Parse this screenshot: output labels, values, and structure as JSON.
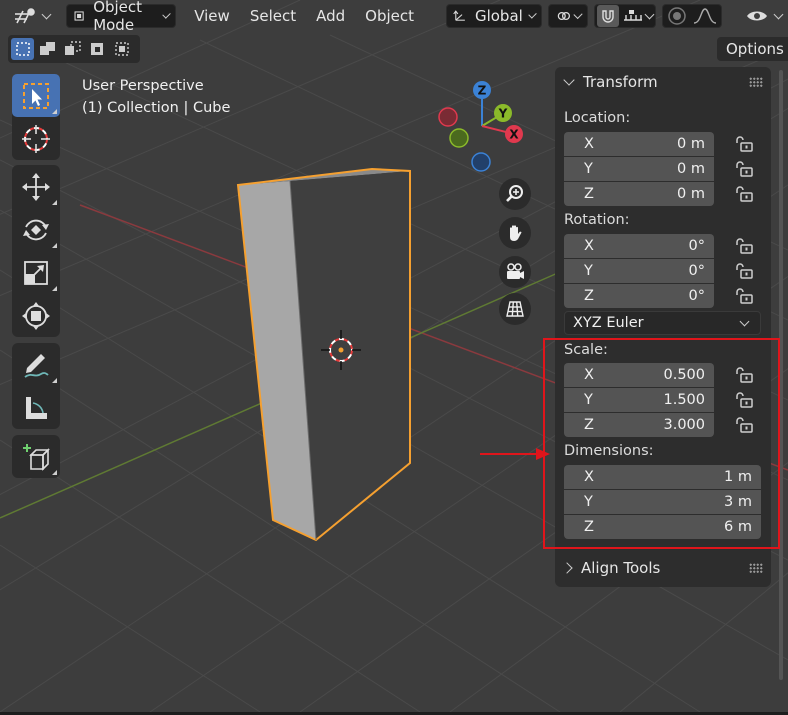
{
  "header": {
    "mode": "Object Mode",
    "menus": [
      "View",
      "Select",
      "Add",
      "Object"
    ],
    "orientation": "Global",
    "options": "Options"
  },
  "viewport": {
    "perspective": "User Perspective",
    "collection": "(1) Collection | Cube",
    "gizmo_axes": {
      "z": "Z",
      "y": "Y",
      "x": "X"
    }
  },
  "panel": {
    "transform_title": "Transform",
    "location_label": "Location:",
    "location": [
      {
        "axis": "X",
        "value": "0 m"
      },
      {
        "axis": "Y",
        "value": "0 m"
      },
      {
        "axis": "Z",
        "value": "0 m"
      }
    ],
    "rotation_label": "Rotation:",
    "rotation": [
      {
        "axis": "X",
        "value": "0°"
      },
      {
        "axis": "Y",
        "value": "0°"
      },
      {
        "axis": "Z",
        "value": "0°"
      }
    ],
    "rotation_mode": "XYZ Euler",
    "scale_label": "Scale:",
    "scale": [
      {
        "axis": "X",
        "value": "0.500"
      },
      {
        "axis": "Y",
        "value": "1.500"
      },
      {
        "axis": "Z",
        "value": "3.000"
      }
    ],
    "dimensions_label": "Dimensions:",
    "dimensions": [
      {
        "axis": "X",
        "value": "1 m"
      },
      {
        "axis": "Y",
        "value": "3 m"
      },
      {
        "axis": "Z",
        "value": "6 m"
      }
    ],
    "align_tools_title": "Align Tools"
  },
  "colors": {
    "accent": "#4772b3",
    "selection_outline": "#f5a030",
    "axis_x": "#e0394e",
    "axis_y": "#8bba2a",
    "axis_z": "#3b82d6",
    "annotation": "#e0151b"
  },
  "icons": {
    "editor_type": "editor-type-icon",
    "tools": [
      "select-box-icon",
      "cursor-icon",
      "move-icon",
      "rotate-icon",
      "scale-icon",
      "transform-icon",
      "annotate-icon",
      "measure-icon",
      "add-cube-icon"
    ],
    "nav": [
      "zoom-icon",
      "hand-pan-icon",
      "camera-icon",
      "grid-perspective-icon"
    ]
  }
}
